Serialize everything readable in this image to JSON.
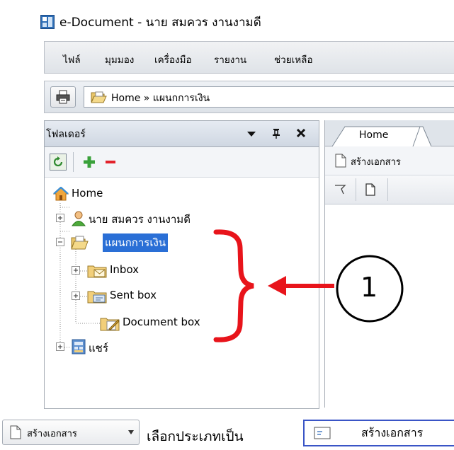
{
  "window": {
    "title": "e-Document - นาย สมควร งานงามดี"
  },
  "menu": {
    "items": [
      "ไฟล์",
      "มุมมอง",
      "เครื่องมือ",
      "รายงาน",
      "ช่วยเหลือ"
    ]
  },
  "address": {
    "path": "Home » แผนกการเงิน"
  },
  "folder_panel": {
    "title": "โฟลเดอร์",
    "tree": {
      "root": "Home",
      "user": "นาย สมควร งานงามดี",
      "department": "แผนกการเงิน",
      "inbox": "Inbox",
      "sent": "Sent box",
      "document": "Document box",
      "share": "แชร์"
    }
  },
  "right_panel": {
    "tab": "Home",
    "new_document": "สร้างเอกสาร"
  },
  "annotation": {
    "callout_number": "1",
    "color": "#e8141b"
  },
  "bottom": {
    "button_label": "สร้างเอกสาร",
    "caption": "เลือกประเภทเป็น",
    "doc_type_label": "สร้างเอกสาร"
  }
}
